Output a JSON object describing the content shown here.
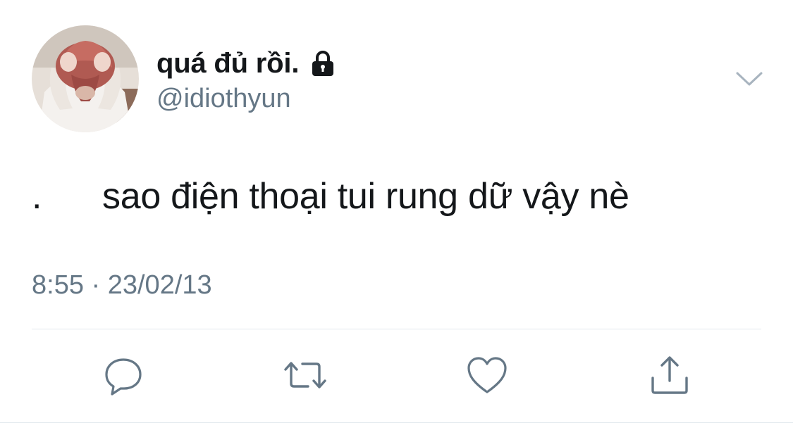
{
  "user": {
    "display_name": "quá đủ rồi.",
    "handle": "@idiothyun",
    "protected_icon": "lock-icon",
    "avatar": "profile-photo"
  },
  "menu": {
    "icon": "chevron-down-icon"
  },
  "tweet": {
    "prefix": ".",
    "text": "sao điện thoại tui rung dữ vậy nè",
    "timestamp": "8:55 · 23/02/13"
  },
  "actions": [
    {
      "icon": "reply-icon"
    },
    {
      "icon": "retweet-icon"
    },
    {
      "icon": "like-icon"
    },
    {
      "icon": "share-icon"
    }
  ],
  "colors": {
    "text": "#14171a",
    "secondary": "#657786",
    "icon": "#657786",
    "divider": "#e1e8ed"
  }
}
